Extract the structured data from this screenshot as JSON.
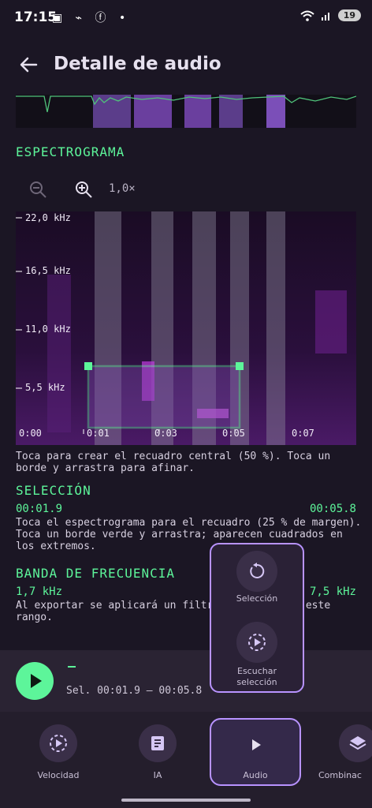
{
  "status_bar": {
    "time": "17:15",
    "battery": "19"
  },
  "app_bar": {
    "title": "Detalle de audio"
  },
  "spectrogram": {
    "heading": "ESPECTROGRAMA",
    "zoom_value": "1,0×",
    "y_labels": [
      "22,0 kHz",
      "16,5 kHz",
      "11,0 kHz",
      "5,5 kHz"
    ],
    "x_labels": [
      "0:00",
      "0:01",
      "0:03",
      "0:05",
      "0:07"
    ],
    "hint": "Toca para crear el recuadro central (50 %). Toca un borde y arrastra para afinar."
  },
  "selection": {
    "heading": "SELECCIÓN",
    "start": "00:01.9",
    "end": "00:05.8",
    "hint": "Toca el espectrograma para el recuadro (25 % de margen). Toca un borde verde y arrastra; aparecen cuadrados en los extremos."
  },
  "frequency_band": {
    "heading": "BANDA DE FRECUENCIA",
    "low": "1,7 kHz",
    "high": "7,5 kHz",
    "hint": "Al exportar se aplicará un filtro de banda con este rango."
  },
  "player": {
    "title": "–",
    "selection_text": "Sel. 00:01.9 – 00:05.8"
  },
  "popup": {
    "item1": "Selección",
    "item2_line1": "Escuchar",
    "item2_line2": "selección"
  },
  "nav": {
    "items": [
      {
        "label": "Velocidad"
      },
      {
        "label": "IA"
      },
      {
        "label": "Audio"
      },
      {
        "label": "Combinac"
      }
    ]
  },
  "colors": {
    "accent": "#5df59a",
    "highlight": "#b893ff"
  }
}
